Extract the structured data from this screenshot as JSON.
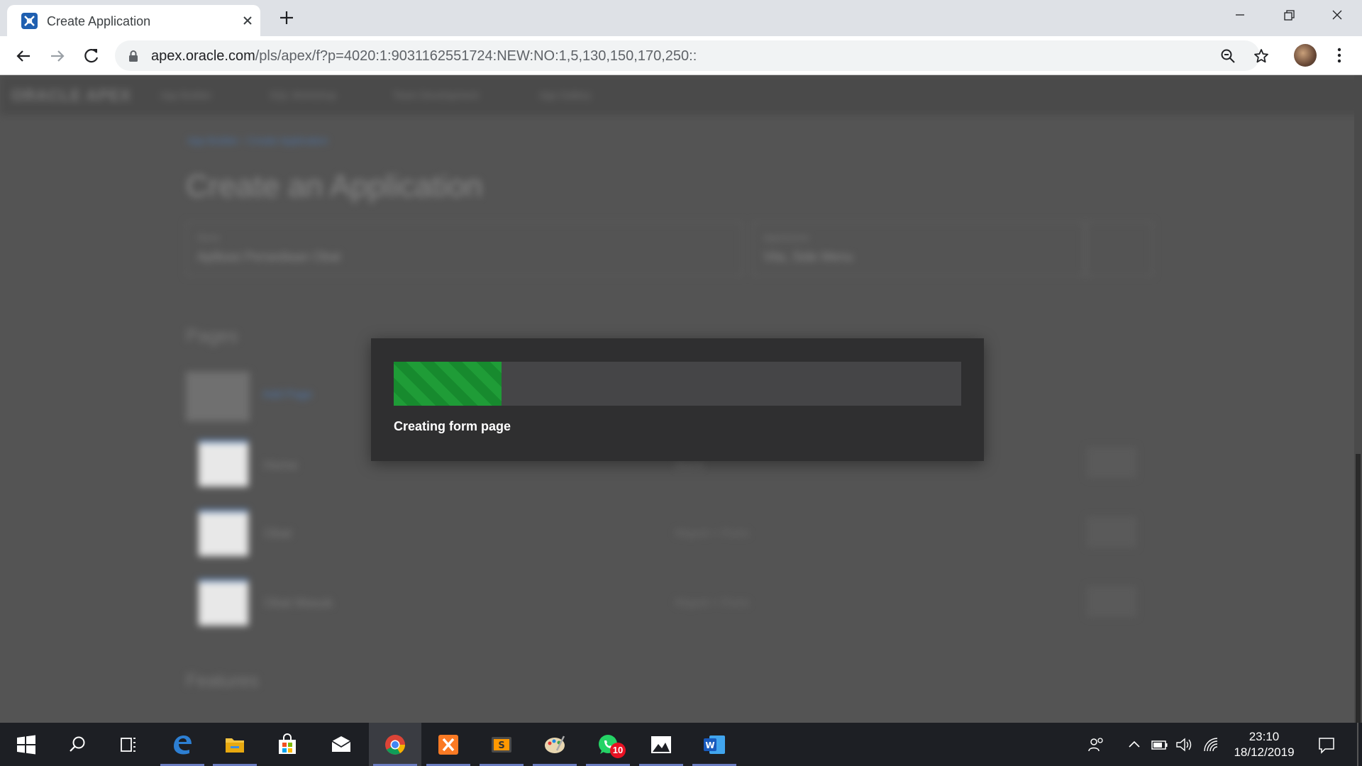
{
  "browser": {
    "tab_title": "Create Application",
    "url_host": "apex.oracle.com",
    "url_path": "/pls/apex/f?p=4020:1:9031162551724:NEW:NO:1,5,130,150,170,250::"
  },
  "background_page": {
    "logo": "ORACLE APEX",
    "nav": [
      "App Builder",
      "SQL Workshop",
      "Team Development",
      "App Gallery"
    ],
    "breadcrumb": "App Builder › Create Application",
    "title": "Create an Application",
    "name_field": {
      "label": "Name",
      "value": "Aplikasi Persediaan Obat"
    },
    "appearance_field": {
      "label": "Appearance",
      "value": "Vita, Side Menu"
    },
    "pages_heading": "Pages",
    "add_page": "Add Page",
    "pages": [
      {
        "name": "Home",
        "desc": "Blank"
      },
      {
        "name": "Obat",
        "desc": "Report + Form"
      },
      {
        "name": "Obat Masuk",
        "desc": "Report + Form"
      }
    ],
    "features_heading": "Features"
  },
  "dialog": {
    "progress_label": "Creating form page",
    "progress_fraction": 0.19,
    "accent_color": "#1f9c37"
  },
  "taskbar": {
    "apps": [
      "windows-start",
      "search",
      "task-view",
      "edge",
      "file-explorer",
      "store",
      "mail",
      "chrome",
      "xampp",
      "sublime-text",
      "paint",
      "whatsapp",
      "photos",
      "word"
    ],
    "active_app": "chrome",
    "whatsapp_badge": "10",
    "time": "23:10",
    "date": "18/12/2019"
  }
}
